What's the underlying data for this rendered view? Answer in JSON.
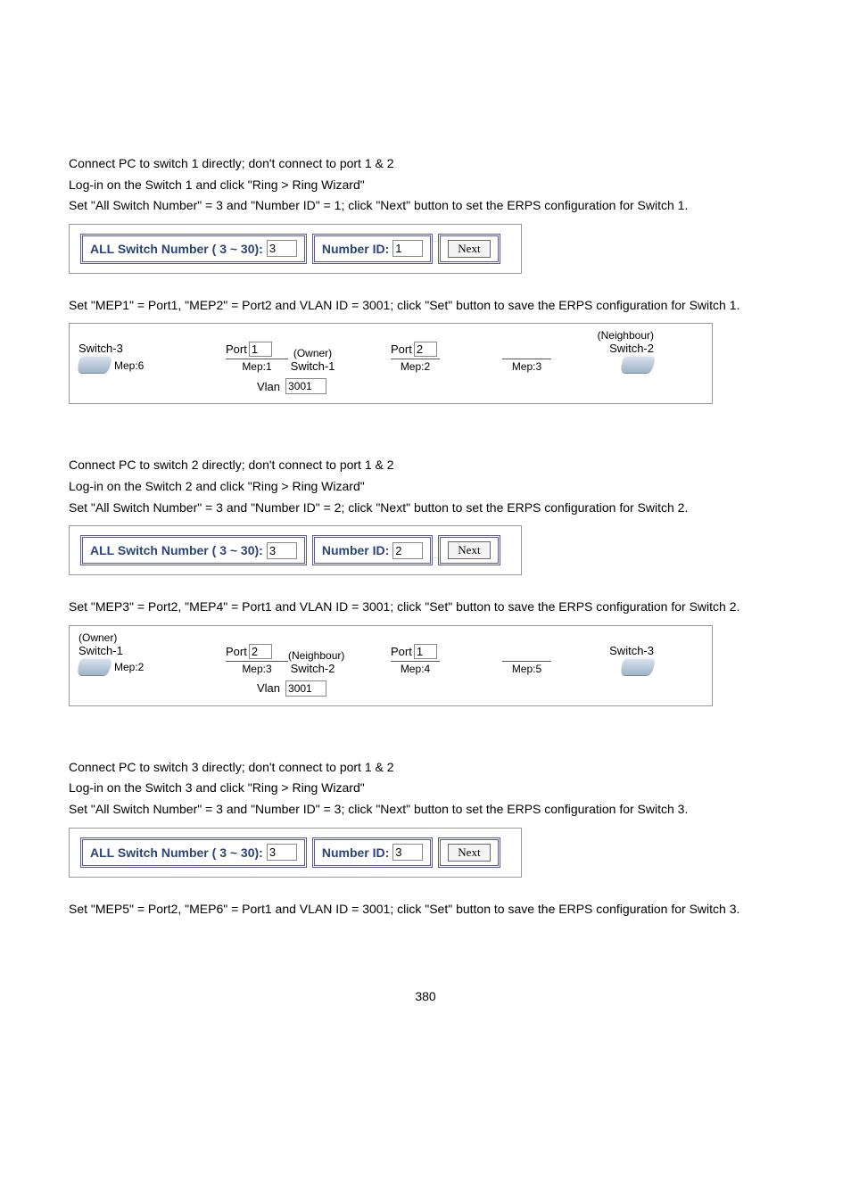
{
  "page_number": "380",
  "sections": [
    {
      "lines": [
        "Connect PC to switch 1 directly; don't connect to port 1 & 2",
        "Log-in on the Switch 1 and click \"Ring > Ring Wizard\"",
        "Set \"All Switch Number\" = 3 and \"Number ID\" = 1; click \"Next\" button to set the ERPS configuration for Switch 1."
      ],
      "wizard": {
        "all_label": "ALL Switch Number ( 3 ~ 30):",
        "all_val": "3",
        "num_label": "Number ID:",
        "num_val": "1",
        "btn": "Next"
      },
      "post": "Set \"MEP1\" = Port1, \"MEP2\" = Port2 and VLAN ID = 3001; click \"Set\" button to save the ERPS configuration for Switch 1.",
      "diagram": {
        "left_top": "",
        "left_name": "Switch-3",
        "left_mep": "Mep:6",
        "owner_a": "(Owner)",
        "mid_name": "Switch-1",
        "port_a_label": "Port",
        "port_a_val": "1",
        "mep_a": "Mep:1",
        "port_b_label": "Port",
        "port_b_val": "2",
        "mep_b": "Mep:2",
        "right_top": "(Neighbour)",
        "right_name": "Switch-2",
        "mep_c": "Mep:3",
        "vlan_label": "Vlan",
        "vlan_val": "3001"
      }
    },
    {
      "lines": [
        "Connect PC to switch 2 directly; don't connect to port 1 & 2",
        "Log-in on the Switch 2 and click \"Ring > Ring Wizard\"",
        "Set \"All Switch Number\" = 3 and \"Number ID\" = 2; click \"Next\" button to set the ERPS configuration for Switch 2."
      ],
      "wizard": {
        "all_label": "ALL Switch Number ( 3 ~ 30):",
        "all_val": "3",
        "num_label": "Number ID:",
        "num_val": "2",
        "btn": "Next"
      },
      "post": "Set \"MEP3\" = Port2, \"MEP4\" = Port1 and VLAN ID = 3001; click \"Set\" button to save the ERPS configuration for Switch 2.",
      "diagram": {
        "left_top": "(Owner)",
        "left_name": "Switch-1",
        "left_mep": "Mep:2",
        "owner_a": "(Neighbour)",
        "mid_name": "Switch-2",
        "port_a_label": "Port",
        "port_a_val": "2",
        "mep_a": "Mep:3",
        "port_b_label": "Port",
        "port_b_val": "1",
        "mep_b": "Mep:4",
        "right_top": "",
        "right_name": "Switch-3",
        "mep_c": "Mep:5",
        "vlan_label": "Vlan",
        "vlan_val": "3001"
      }
    },
    {
      "lines": [
        "Connect PC to switch 3 directly; don't connect to port 1 & 2",
        "Log-in on the Switch 3 and click \"Ring > Ring Wizard\"",
        "Set \"All Switch Number\" = 3 and \"Number ID\" = 3; click \"Next\" button to set the ERPS configuration for Switch 3."
      ],
      "wizard": {
        "all_label": "ALL Switch Number ( 3 ~ 30):",
        "all_val": "3",
        "num_label": "Number ID:",
        "num_val": "3",
        "btn": "Next"
      },
      "post": "Set \"MEP5\" = Port2, \"MEP6\" = Port1 and VLAN ID = 3001; click \"Set\" button to save the ERPS configuration for Switch 3."
    }
  ]
}
